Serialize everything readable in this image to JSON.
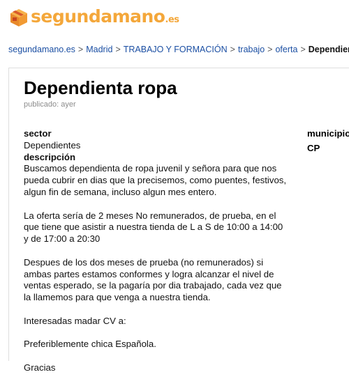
{
  "header": {
    "logo_name": "box-logo-icon",
    "logo_main": "segundamano",
    "logo_suffix": ".es",
    "brand_color": "#f4a73a"
  },
  "breadcrumb": [
    "segundamano.es",
    "Madrid",
    "TRABAJO Y FORMACIÓN",
    "trabajo",
    "oferta"
  ],
  "breadcrumb_current": "Dependienta ropa",
  "breadcrumb_separator": ">",
  "ad": {
    "title": "Dependienta ropa",
    "published": "publicado: ayer",
    "sector_label": "sector",
    "sector_value": "Dependientes",
    "description_label": "descripción",
    "description": [
      "Buscamos dependienta de ropa juvenil y señora para que nos pueda cubrir en dias que la precisemos, como puentes, festivos, algun fin de semana, incluso algun mes entero.",
      "La oferta sería de 2 meses No remunerados, de prueba, en el que tiene que asistir a nuestra tienda de L a S de 10:00 a 14:00 y de 17:00 a 20:30",
      "Despues de los dos meses de prueba (no remunerados) si ambas partes estamos conformes y logra alcanzar el nivel de ventas esperado, se la pagaría por dia trabajado, cada vez que la llamemos para que venga a nuestra tienda.",
      "Interesadas madar CV a:",
      "Preferiblemente chica Española.",
      "Gracias"
    ],
    "side_municipio": "municipio",
    "side_cp": "CP"
  }
}
